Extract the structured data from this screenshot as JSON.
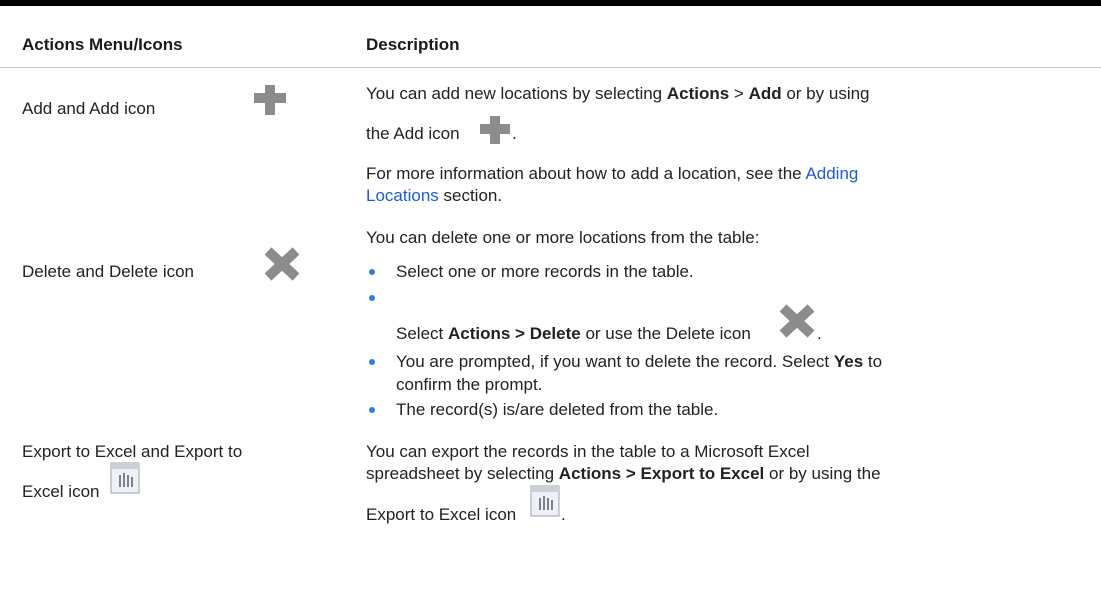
{
  "table": {
    "headers": [
      "Actions Menu/Icons",
      "Description"
    ],
    "rows": {
      "add": {
        "label": "Add and Add icon",
        "icon": "plus-icon",
        "desc1_pre": "You can add new locations by selecting ",
        "desc1_b1": "Actions",
        "desc1_mid": " > ",
        "desc1_b2": "Add",
        "desc1_post": " or by using",
        "desc2": "the Add icon",
        "desc2_end": ".",
        "info_pre": "For more information about how to add a location, see the ",
        "info_link1": "Adding",
        "info_link2": "Locations",
        "info_post": " section."
      },
      "delete": {
        "label": "Delete and Delete icon",
        "icon": "x-icon",
        "intro": "You can delete one or more locations from the table:",
        "b1": "Select one or more records in the table.",
        "b2_pre": "Select ",
        "b2_bold": "Actions > Delete",
        "b2_post": " or use the Delete icon",
        "b2_end": ".",
        "b3_pre": "You are prompted, if you want to delete the record. Select ",
        "b3_bold": "Yes",
        "b3_post": " to",
        "b3_line2": "confirm the prompt.",
        "b4": "The record(s) is/are deleted from the table."
      },
      "export": {
        "label1": "Export to Excel and Export to",
        "label2": "Excel icon",
        "icon": "spreadsheet-icon",
        "d1": "You can export the records in the table to a Microsoft Excel",
        "d2_pre": "spreadsheet by selecting ",
        "d2_bold": "Actions > Export to Excel",
        "d2_post": " or by using the",
        "d3": "Export to Excel icon",
        "d3_end": "."
      }
    }
  },
  "colors": {
    "link": "#1f5bd4",
    "bullet": "#2d7fd1",
    "icon_gray": "#8c8c8c"
  }
}
